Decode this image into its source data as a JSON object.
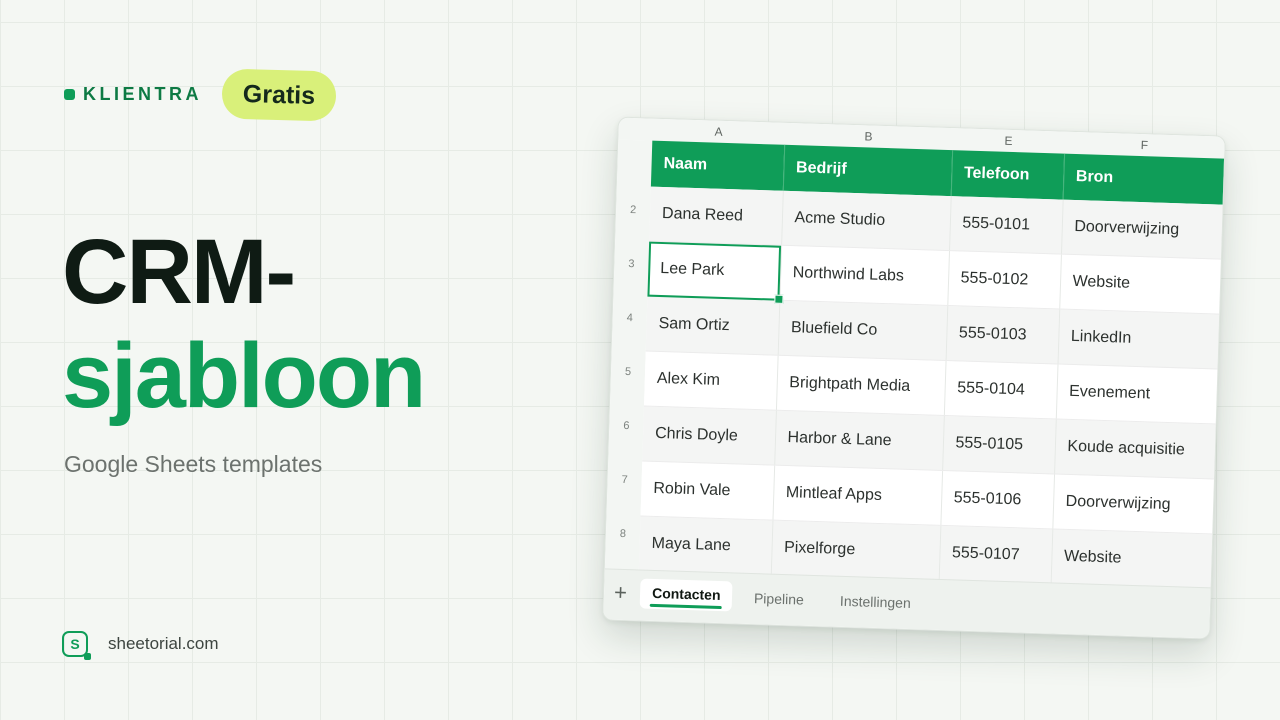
{
  "brand": {
    "name": "KLIENTRA",
    "badge": "Gratis"
  },
  "hero": {
    "title_line1": "CRM-",
    "title_line2": "sjabloon",
    "subtitle": "Google Sheets templates"
  },
  "footer": {
    "logo_letter": "S",
    "site": "sheetorial.com"
  },
  "colors": {
    "accent": "#0f9d58",
    "badge": "#d9f07a",
    "dark_text": "#0f1b14"
  },
  "sheet": {
    "column_letters": [
      "A",
      "B",
      "E",
      "F"
    ],
    "row_numbers": [
      "2",
      "3",
      "4",
      "5",
      "6",
      "7",
      "8"
    ],
    "headers": [
      "Naam",
      "Bedrijf",
      "Telefoon",
      "Bron"
    ],
    "rows": [
      [
        "Dana Reed",
        "Acme Studio",
        "555-0101",
        "Doorverwijzing"
      ],
      [
        "Lee Park",
        "Northwind Labs",
        "555-0102",
        "Website"
      ],
      [
        "Sam Ortiz",
        "Bluefield Co",
        "555-0103",
        "LinkedIn"
      ],
      [
        "Alex Kim",
        "Brightpath Media",
        "555-0104",
        "Evenement"
      ],
      [
        "Chris Doyle",
        "Harbor & Lane",
        "555-0105",
        "Koude acquisitie"
      ],
      [
        "Robin Vale",
        "Mintleaf Apps",
        "555-0106",
        "Doorverwijzing"
      ],
      [
        "Maya Lane",
        "Pixelforge",
        "555-0107",
        "Website"
      ]
    ],
    "selected_cell": "Lee Park",
    "add_icon": "plus-icon",
    "add_label": "+",
    "tabs": [
      "Contacten",
      "Pipeline",
      "Instellingen"
    ],
    "active_tab": "Contacten"
  }
}
